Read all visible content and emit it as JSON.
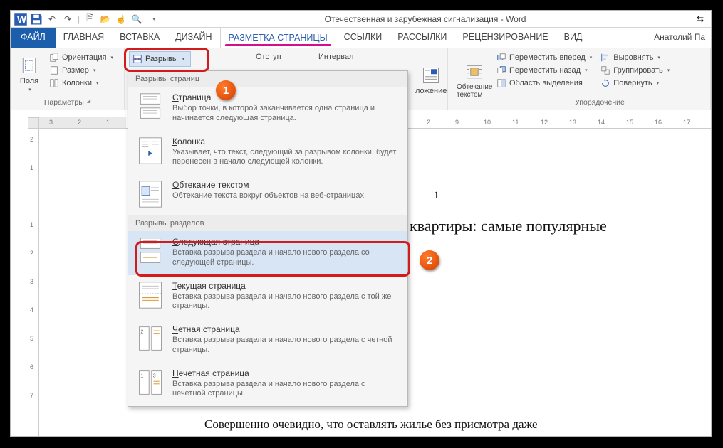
{
  "title": "Отечественная и зарубежная сигнализация - Word",
  "user": "Анатолий Па",
  "tabs": {
    "file": "ФАЙЛ",
    "home": "ГЛАВНАЯ",
    "insert": "ВСТАВКА",
    "design": "ДИЗАЙН",
    "layout": "РАЗМЕТКА СТРАНИЦЫ",
    "references": "ССЫЛКИ",
    "mailings": "РАССЫЛКИ",
    "review": "РЕЦЕНЗИРОВАНИЕ",
    "view": "ВИД"
  },
  "ribbon": {
    "margins": "Поля",
    "orientation": "Ориентация",
    "size": "Размер",
    "columns": "Колонки",
    "breaks": "Разрывы",
    "group_page_setup": "Параметры",
    "indent": "Отступ",
    "spacing": "Интервал",
    "position": "ложение",
    "wrap": "Обтекание текстом",
    "bring_forward": "Переместить вперед",
    "send_backward": "Переместить назад",
    "selection_pane": "Область выделения",
    "align": "Выровнять",
    "group_obj": "Группировать",
    "rotate": "Повернуть",
    "group_arrange": "Упорядочение"
  },
  "dropdown": {
    "cat1": "Разрывы страниц",
    "items1": [
      {
        "title": "Страница",
        "u": "С",
        "desc": "Выбор точки, в которой заканчивается одна страница и начинается следующая страница."
      },
      {
        "title": "Колонка",
        "u": "К",
        "desc": "Указывает, что текст, следующий за разрывом колонки, будет перенесен в начало следующей колонки."
      },
      {
        "title": "Обтекание текстом",
        "u": "О",
        "desc": "Обтекание текста вокруг объектов на веб-страницах."
      }
    ],
    "cat2": "Разрывы разделов",
    "items2": [
      {
        "title": "Следующая страница",
        "u": "С",
        "desc": "Вставка разрыва раздела и начало нового раздела со следующей страницы."
      },
      {
        "title": "Текущая страница",
        "u": "Т",
        "desc": "Вставка разрыва раздела и начало нового раздела с той же страницы."
      },
      {
        "title": "Четная страница",
        "u": "Ч",
        "desc": "Вставка разрыва раздела и начало нового раздела с четной страницы."
      },
      {
        "title": "Нечетная страница",
        "u": "Н",
        "desc": "Вставка разрыва раздела и начало нового раздела с нечетной страницы."
      }
    ]
  },
  "doc": {
    "num": "1",
    "heading_fragment": "квартиры: самые популярные",
    "body_fragment": "Совершенно очевидно, что оставлять жилье без присмотра даже"
  },
  "hruler_numbers": [
    "3",
    "2",
    "1",
    "1",
    "2",
    "9",
    "10",
    "11",
    "12",
    "13",
    "14",
    "15",
    "16",
    "17"
  ],
  "vruler_numbers": [
    "2",
    "1",
    "1",
    "2",
    "3",
    "4",
    "5",
    "6",
    "7"
  ],
  "callouts": {
    "one": "1",
    "two": "2"
  }
}
